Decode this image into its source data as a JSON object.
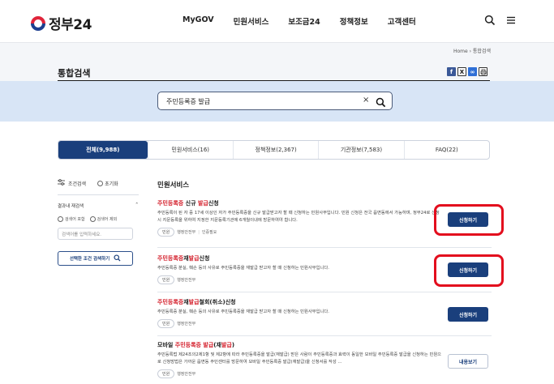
{
  "header": {
    "logo_text": "정부24",
    "nav": [
      "MyGOV",
      "민원서비스",
      "보조금24",
      "정책정보",
      "고객센터"
    ]
  },
  "breadcrumb": {
    "home": "Home",
    "separator": "›",
    "current": "통합검색"
  },
  "page": {
    "title": "통합검색"
  },
  "search": {
    "value": "주민등록증 발급"
  },
  "tabs": [
    {
      "label": "전체(9,988)",
      "active": true
    },
    {
      "label": "민원서비스(16)",
      "active": false
    },
    {
      "label": "정책정보(2,367)",
      "active": false
    },
    {
      "label": "기관정보(7,583)",
      "active": false
    },
    {
      "label": "FAQ(22)",
      "active": false
    }
  ],
  "sidebar": {
    "title": "조건검색",
    "reset": "초기화",
    "sub_title": "결과내 재검색",
    "options": [
      "검색어 포함",
      "검색어 제외"
    ],
    "input_placeholder": "검색어를 입력하세요.",
    "search_button": "선택한 조건 검색하기"
  },
  "results": {
    "section_title": "민원서비스",
    "items": [
      {
        "title_red": "주민등록증",
        "title_mid": " 신규 ",
        "title_red2": "발급",
        "title_end": "신청",
        "desc": "주민등록이 된 자 중 17세 이상인 자가 주민등록증을 신규 발급받고자 할 때 신청하는 민원사무입니다. 민원 신청은 전국 읍면동에서 가능하며, 정부24로 신청시 지문등록을 위하여 지정한 지문등록기관에 6개월이내에 방문하여야 합니다.",
        "tag": "민원",
        "org": "행정안전부",
        "extra": "인증필요",
        "button": "신청하기"
      },
      {
        "title_red": "주민등록증",
        "title_mid": "재",
        "title_red2": "발급",
        "title_end": "신청",
        "desc": "주민등록증 분실, 훼손 등의 사유로 주민등록증을 재발급 받고자 할 때 신청하는 민원사무입니다.",
        "tag": "민원",
        "org": "행정안전부",
        "button": "신청하기"
      },
      {
        "title_red": "주민등록증",
        "title_mid": "재",
        "title_red2": "발급",
        "title_end": "철회(취소)신청",
        "desc": "주민등록증 분실, 훼손 등의 사유로 주민등록증을 재발급 받고자 할 때 신청하는 민원사무입니다.",
        "tag": "민원",
        "org": "행정안전부",
        "button": "신청하기"
      },
      {
        "title_pre": "모바일 ",
        "title_red": "주민등록증 발급",
        "title_mid": "(재",
        "title_red2": "발급",
        "title_end": ")",
        "desc": "주민등록법 제24조의2제1항 및 제2항에 따라 주민등록증을 발급(재발급) 받은 사람이 주민등록증과 효력이 동일한 모바일 주민등록증 발급을 신청하는 민원으로 신청방법은 가까운 읍면동 주민센터를 방문하여 모바일 주민등록증 발급(재발급)을 신청서를 작성 ...",
        "tag": "민원",
        "org": "행정안전부",
        "button": "내용보기"
      }
    ]
  }
}
